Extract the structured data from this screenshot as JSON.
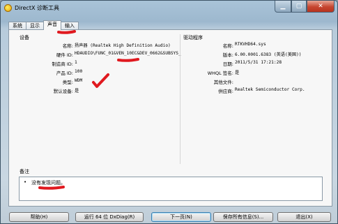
{
  "window": {
    "title": "DirectX 诊断工具"
  },
  "tabs": [
    {
      "label": "系统"
    },
    {
      "label": "显示"
    },
    {
      "label": "声音"
    },
    {
      "label": "输入"
    }
  ],
  "device": {
    "group_label": "设备",
    "fields": [
      {
        "label": "名称:",
        "value": "扬声器 (Realtek High Definition Audio)"
      },
      {
        "label": "硬件 ID:",
        "value": "HDAUDIO\\FUNC_01&VEN_10EC&DEV_0662&SUBSYS_"
      },
      {
        "label": "制造商 ID:",
        "value": "1"
      },
      {
        "label": "产品 ID:",
        "value": "100"
      },
      {
        "label": "类型:",
        "value": "WDM"
      },
      {
        "label": "默认设备:",
        "value": "是"
      }
    ]
  },
  "driver": {
    "group_label": "驱动程序",
    "fields": [
      {
        "label": "名称:",
        "value": "RTKVHD64.sys"
      },
      {
        "label": "版本:",
        "value": "6.00.0001.6383 (英语(美国))"
      },
      {
        "label": "日期:",
        "value": "2011/5/31 17:21:28"
      },
      {
        "label": "WHQL 签名:",
        "value": "是"
      },
      {
        "label": "其他文件:",
        "value": ""
      },
      {
        "label": "供应商:",
        "value": "Realtek Semiconductor Corp."
      }
    ]
  },
  "notes": {
    "group_label": "备注",
    "bullet": "•",
    "text": "没有发现问题。"
  },
  "buttons": {
    "help": "帮助(H)",
    "run64": "运行 64 位 DxDiag(R)",
    "next_page": "下一页(N)",
    "save_all": "保存所有信息(S)...",
    "exit": "退出(X)"
  },
  "icons": {
    "app": "directx-icon",
    "minimize": "minimize-icon",
    "maximize": "maximize-icon",
    "close": "close-icon"
  },
  "colors": {
    "annotation_red": "#e0191f"
  }
}
